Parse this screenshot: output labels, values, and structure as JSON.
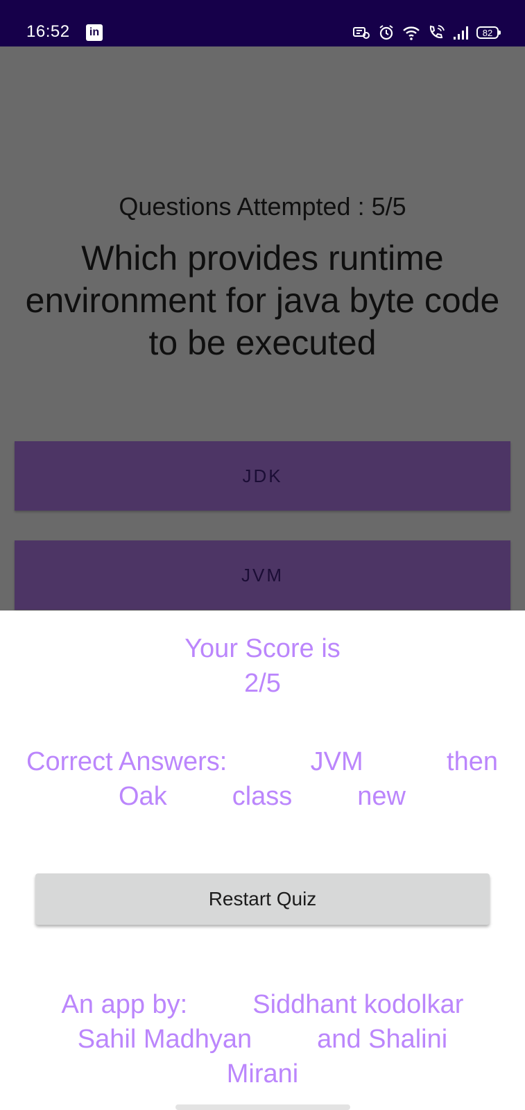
{
  "status_bar": {
    "time": "16:52",
    "linkedin_glyph": "in",
    "battery": "82"
  },
  "quiz": {
    "attempted": "Questions Attempted : 5/5",
    "question": "Which provides runtime environment for java byte code to be executed",
    "options": [
      "JDK",
      "JVM"
    ]
  },
  "result": {
    "score_title": "Your Score is",
    "score_value": "2/5",
    "answers_label": "Correct Answers:",
    "answers": [
      "JVM",
      "then",
      "Oak",
      "class",
      "new"
    ],
    "restart_label": "Restart Quiz",
    "credit_label": "An app by:",
    "credit_names": [
      "Siddhant kodolkar",
      "Sahil Madhyan",
      "and Shalini",
      "Mirani"
    ]
  },
  "colors": {
    "accent": "#bb86fc",
    "status_bar": "#16004a",
    "option_bg": "#4d3565",
    "overlay": "#6a6a6a"
  }
}
